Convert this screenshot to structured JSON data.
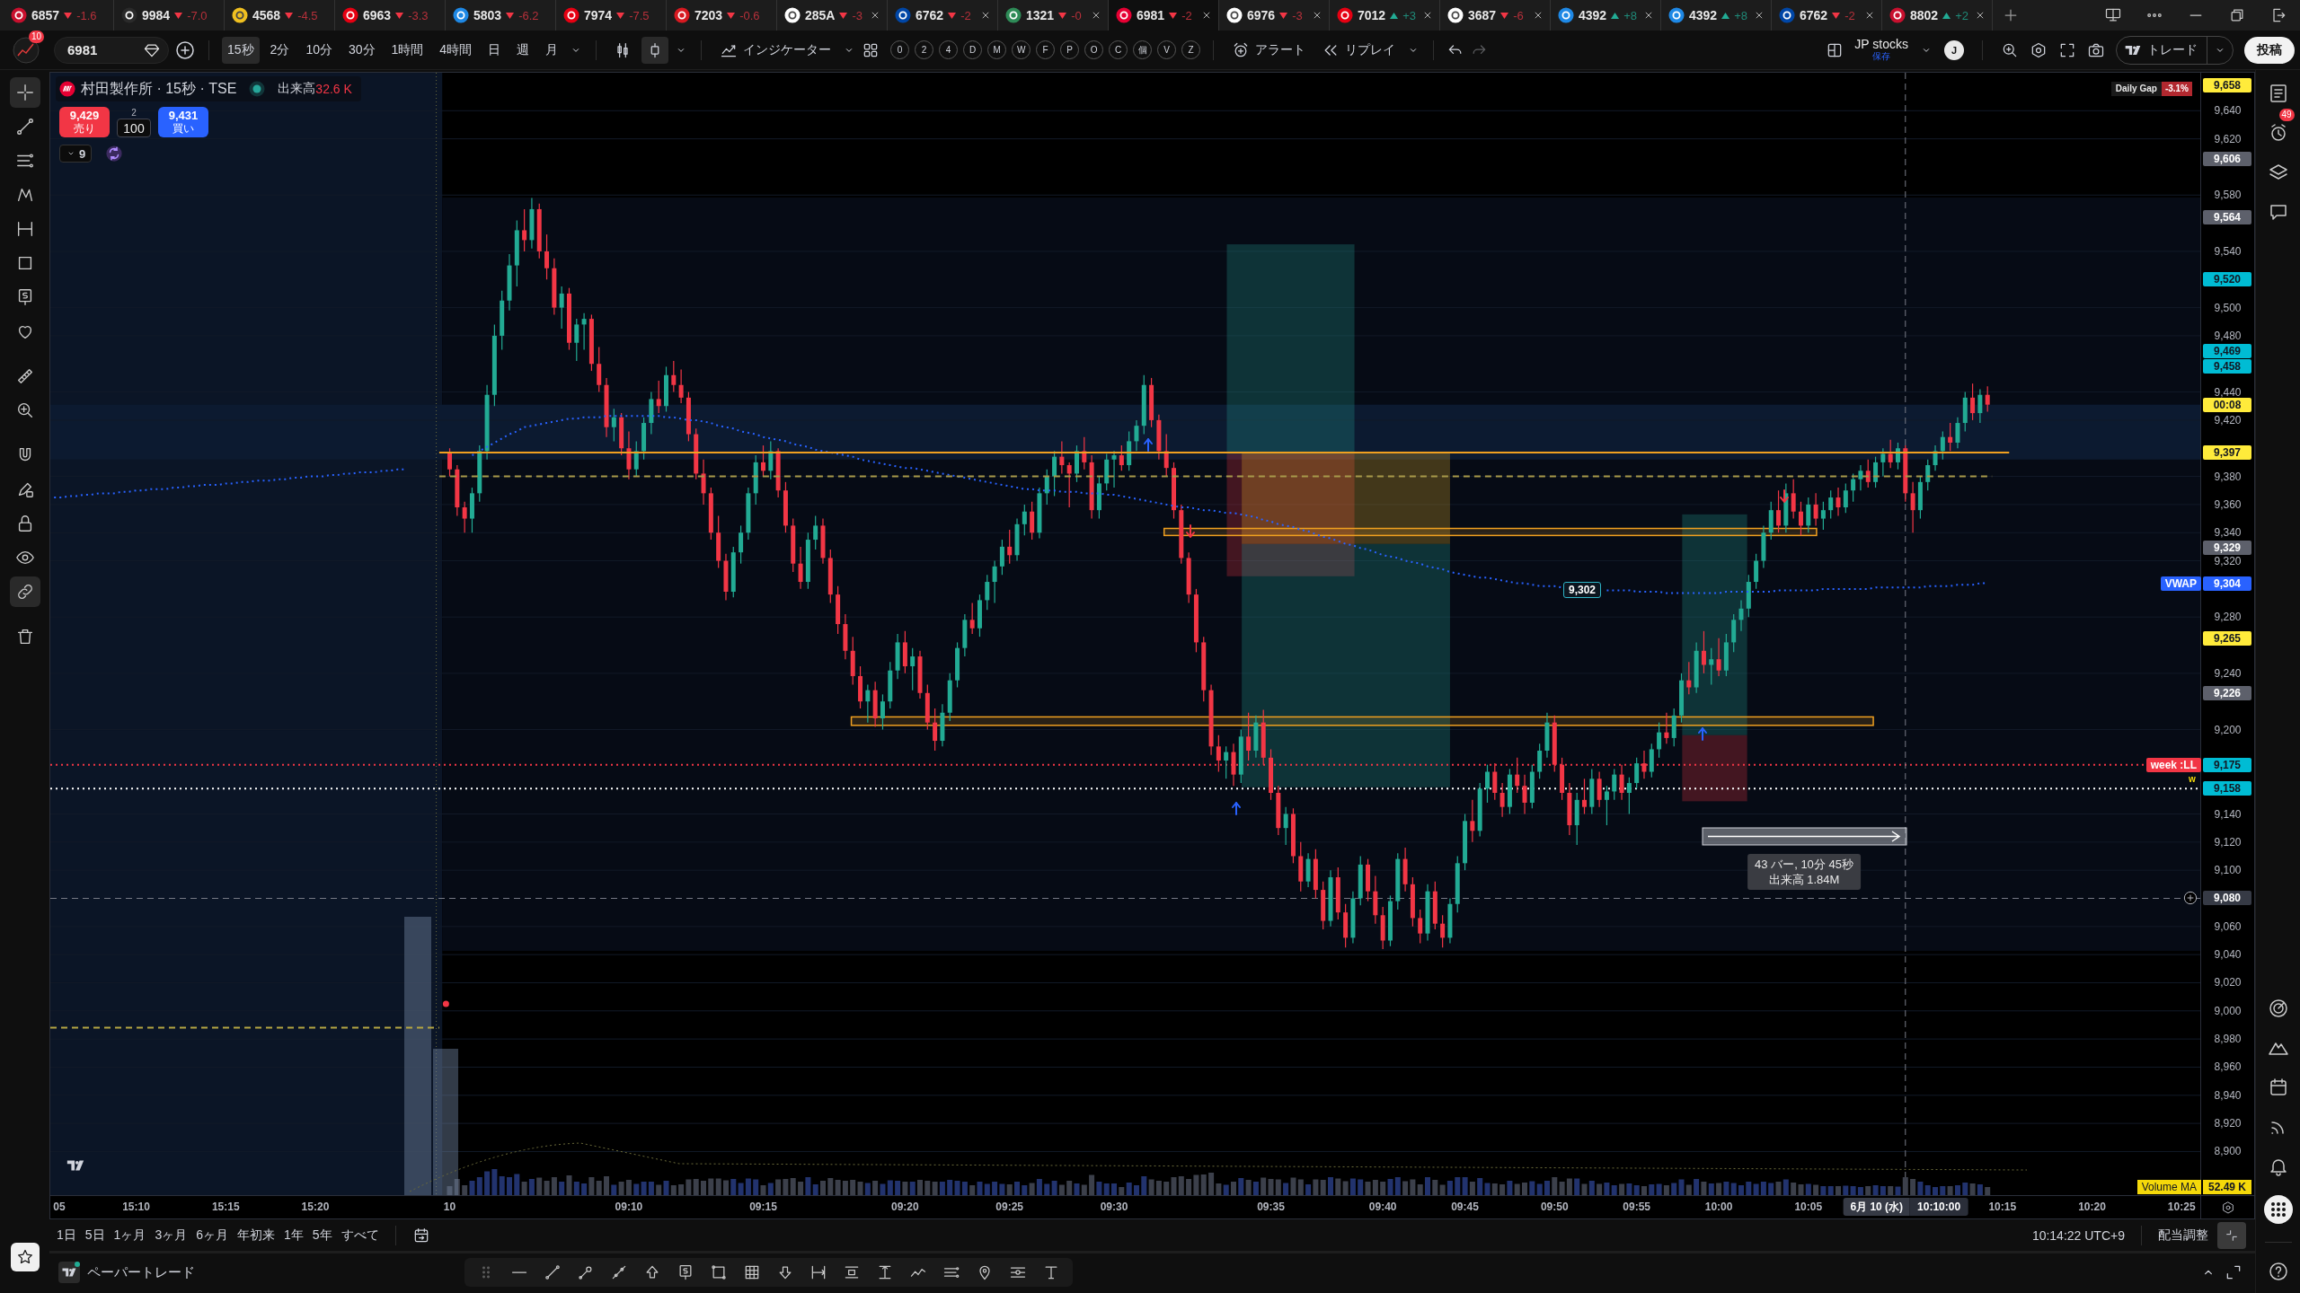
{
  "tabs": [
    {
      "symbol": "6857",
      "rising": false,
      "change": "-1.6",
      "color": "#c8102e",
      "closable": false,
      "selected": false
    },
    {
      "symbol": "9984",
      "rising": false,
      "change": "-7.0",
      "color": "#2a2a2a",
      "closable": false,
      "selected": false
    },
    {
      "symbol": "4568",
      "rising": false,
      "change": "-4.5",
      "color": "#f0c020",
      "closable": false,
      "selected": false
    },
    {
      "symbol": "6963",
      "rising": false,
      "change": "-3.3",
      "color": "#e60012",
      "closable": false,
      "selected": false
    },
    {
      "symbol": "5803",
      "rising": false,
      "change": "-6.2",
      "color": "#1e88e5",
      "closable": false,
      "selected": false
    },
    {
      "symbol": "7974",
      "rising": false,
      "change": "-7.5",
      "color": "#e60012",
      "closable": false,
      "selected": false
    },
    {
      "symbol": "7203",
      "rising": false,
      "change": "-0.6",
      "color": "#d71920",
      "closable": false,
      "selected": false
    },
    {
      "symbol": "285A",
      "rising": false,
      "change": "-3",
      "color": "#ffffff",
      "closable": true,
      "selected": false
    },
    {
      "symbol": "6762",
      "rising": false,
      "change": "-2",
      "color": "#0046a6",
      "closable": true,
      "selected": false
    },
    {
      "symbol": "1321",
      "rising": false,
      "change": "-0",
      "color": "#2e8b57",
      "closable": true,
      "selected": false
    },
    {
      "symbol": "6981",
      "rising": false,
      "change": "-2",
      "color": "#e60033",
      "closable": true,
      "selected": true
    },
    {
      "symbol": "6976",
      "rising": false,
      "change": "-3",
      "color": "#ffffff",
      "closable": true,
      "selected": false
    },
    {
      "symbol": "7012",
      "rising": true,
      "change": "+3",
      "color": "#e60012",
      "closable": true,
      "selected": false
    },
    {
      "symbol": "3687",
      "rising": false,
      "change": "-6",
      "color": "#ffffff",
      "closable": true,
      "selected": false
    },
    {
      "symbol": "4392",
      "rising": true,
      "change": "+8",
      "color": "#1e88e5",
      "closable": true,
      "selected": false
    },
    {
      "symbol": "4392",
      "rising": true,
      "change": "+8",
      "color": "#1e88e5",
      "closable": true,
      "selected": false
    },
    {
      "symbol": "6762",
      "rising": false,
      "change": "-2",
      "color": "#0046a6",
      "closable": true,
      "selected": false
    },
    {
      "symbol": "8802",
      "rising": true,
      "change": "+2",
      "color": "#c8102e",
      "closable": true,
      "selected": false
    }
  ],
  "toolbar": {
    "avatar_badge": "10",
    "symbol": "6981",
    "intervals": [
      {
        "label": "15秒",
        "selected": true
      },
      {
        "label": "2分",
        "selected": false
      },
      {
        "label": "10分",
        "selected": false
      },
      {
        "label": "30分",
        "selected": false
      },
      {
        "label": "1時間",
        "selected": false
      },
      {
        "label": "4時間",
        "selected": false
      },
      {
        "label": "日",
        "selected": false
      },
      {
        "label": "週",
        "selected": false
      },
      {
        "label": "月",
        "selected": false
      }
    ],
    "chart_types": [
      {
        "kind": "candles",
        "selected": false
      },
      {
        "kind": "hollow",
        "selected": true
      }
    ],
    "indicators": "インジケーター",
    "quick_buttons": [
      "0",
      "2",
      "4",
      "D",
      "M",
      "W",
      "F",
      "P",
      "O",
      "C",
      "個",
      "V",
      "Z"
    ],
    "alert": "アラート",
    "replay": "リプレイ",
    "layout_name": "JP stocks",
    "layout_status": "保存",
    "user_initial": "J",
    "trade": "トレード",
    "publish": "投稿"
  },
  "left_tools": [
    {
      "selected": true
    },
    {
      "selected": false
    },
    {
      "selected": false
    },
    {
      "selected": false
    },
    {
      "selected": false
    },
    {
      "selected": false
    },
    {
      "selected": false
    },
    {
      "selected": false
    },
    {
      "selected": false
    },
    {
      "selected": false
    },
    {
      "selected": false
    },
    {
      "selected": false
    },
    {
      "selected": false
    },
    {
      "selected": false
    },
    {
      "selected": true
    },
    {
      "selected": false
    }
  ],
  "chart": {
    "legend": {
      "title": "村田製作所 · 15秒 · TSE",
      "market_open": true,
      "volume_label": "出来高",
      "volume": "32.6 K",
      "sell_price": "9,429",
      "sell_label": "売り",
      "spread": "2",
      "quantity": "100",
      "buy_price": "9,431",
      "buy_label": "買い",
      "indicator_count": "9"
    },
    "daily_gap": {
      "label": "Daily Gap",
      "value": "-3.1%"
    },
    "measure": {
      "bars": "43 バー, 10分 45秒",
      "volume": "出来高 1.84M"
    },
    "crosshair": {
      "date": "6月 10 (水)",
      "time": "10:10:00"
    },
    "volume_ma": {
      "label": "Volume MA",
      "value": "52.49 K"
    },
    "price_scale": {
      "countdown": "00:08",
      "tags": [
        {
          "label": "9,658",
          "color": "#ffeb3b"
        },
        {
          "label": "9,606",
          "color": "#5d606b"
        },
        {
          "label": "9,564",
          "color": "#5d606b"
        },
        {
          "label": "9,520",
          "color": "#00bcd4"
        },
        {
          "label": "9,469",
          "color": "#00bcd4"
        },
        {
          "label": "9,458",
          "color": "#00bcd4"
        },
        {
          "label": "9,397",
          "color": "#ffeb3b"
        },
        {
          "label": "9,329",
          "color": "#5d606b"
        },
        {
          "label": "9,304",
          "color": "#2962ff"
        },
        {
          "label": "9,265",
          "color": "#ffeb3b"
        },
        {
          "label": "9,226",
          "color": "#5d606b"
        },
        {
          "label": "9,175",
          "color": "#00bcd4"
        },
        {
          "label": "9,158",
          "color": "#00bcd4"
        },
        {
          "label": "9,080",
          "color": "#363a45"
        }
      ]
    },
    "chart_data": {
      "type": "candlestick",
      "ylim": [
        8869,
        9667
      ],
      "grid": true,
      "categories": [
        "05",
        null,
        null,
        null,
        null,
        null,
        null,
        null,
        null,
        null,
        null,
        "15:10",
        null,
        null,
        null,
        null,
        null,
        null,
        null,
        null,
        null,
        null,
        null,
        "15:15",
        null,
        null,
        null,
        null,
        null,
        null,
        null,
        null,
        null,
        null,
        null,
        "15:20",
        null,
        null,
        null,
        null,
        null,
        null,
        null,
        null,
        null,
        null,
        null,
        null,
        null,
        null,
        null,
        null,
        null,
        "10",
        null,
        null,
        null,
        null,
        null,
        null,
        null,
        null,
        null,
        null,
        null,
        null,
        null,
        null,
        null,
        null,
        null,
        null,
        null,
        null,
        null,
        null,
        null,
        "09:10",
        null,
        null,
        null,
        null,
        null,
        null,
        null,
        null,
        null,
        null,
        null,
        null,
        null,
        null,
        null,
        null,
        null,
        "09:15",
        null,
        null,
        null,
        null,
        null,
        null,
        null,
        null,
        null,
        null,
        null,
        null,
        null,
        null,
        null,
        null,
        null,
        null,
        "09:20",
        null,
        null,
        null,
        null,
        null,
        null,
        null,
        null,
        null,
        null,
        null,
        null,
        null,
        "09:25",
        null,
        null,
        null,
        null,
        null,
        null,
        null,
        null,
        null,
        null,
        null,
        null,
        null,
        "09:30",
        null,
        null,
        null,
        null,
        null,
        null,
        null,
        null,
        null,
        null,
        null,
        null,
        null,
        null,
        null,
        null,
        null,
        null,
        null,
        null,
        "09:35",
        null,
        null,
        null,
        null,
        null,
        null,
        null,
        null,
        null,
        null,
        null,
        null,
        null,
        null,
        "09:40",
        null,
        null,
        null,
        null,
        null,
        null,
        null,
        null,
        null,
        null,
        "09:45",
        null,
        null,
        null,
        null,
        null,
        null,
        null,
        null,
        null,
        null,
        null,
        "09:50",
        null,
        null,
        null,
        null,
        null,
        null,
        null,
        null,
        null,
        null,
        "09:55",
        null,
        null,
        null,
        null,
        null,
        null,
        null,
        null,
        null,
        null,
        "10:00",
        null,
        null,
        null,
        null,
        null,
        null,
        null,
        null,
        null,
        null,
        null,
        "10:05",
        null,
        null,
        null,
        null,
        null,
        null,
        null,
        null,
        null,
        null,
        null,
        null,
        null,
        null,
        null,
        null,
        null,
        null,
        null,
        null,
        null,
        null,
        null,
        null,
        null,
        "10:15",
        null,
        null,
        null,
        null,
        null,
        null,
        null,
        null,
        null,
        null,
        null,
        "10:20",
        null,
        null,
        null,
        null,
        null,
        null,
        null,
        null,
        null,
        null,
        null,
        "10:25",
        null,
        null
      ],
      "yticks": [
        {
          "value": 9640,
          "label": "9,640"
        },
        {
          "value": 9620,
          "label": "9,620"
        },
        {
          "value": 9580,
          "label": "9,580"
        },
        {
          "value": 9540,
          "label": "9,540"
        },
        {
          "value": 9500,
          "label": "9,500"
        },
        {
          "value": 9480,
          "label": "9,480"
        },
        {
          "value": 9440,
          "label": "9,440"
        },
        {
          "value": 9420,
          "label": "9,420"
        },
        {
          "value": 9380,
          "label": "9,380"
        },
        {
          "value": 9360,
          "label": "9,360"
        },
        {
          "value": 9340,
          "label": "9,340"
        },
        {
          "value": 9320,
          "label": "9,320"
        },
        {
          "value": 9280,
          "label": "9,280"
        },
        {
          "value": 9240,
          "label": "9,240"
        },
        {
          "value": 9200,
          "label": "9,200"
        },
        {
          "value": 9140,
          "label": "9,140"
        },
        {
          "value": 9120,
          "label": "9,120"
        },
        {
          "value": 9100,
          "label": "9,100"
        },
        {
          "value": 9060,
          "label": "9,060"
        },
        {
          "value": 9040,
          "label": "9,040"
        },
        {
          "value": 9020,
          "label": "9,020"
        },
        {
          "value": 9000,
          "label": "9,000"
        },
        {
          "value": 8980,
          "label": "8,980"
        },
        {
          "value": 8960,
          "label": "8,960"
        },
        {
          "value": 8940,
          "label": "8,940"
        },
        {
          "value": 8920,
          "label": "8,920"
        },
        {
          "value": 8900,
          "label": "8,900"
        }
      ],
      "bands": [
        {
          "axis": "y",
          "from": 9392,
          "to": 9431,
          "color": "#0c1a30"
        }
      ],
      "ohlc": [
        null,
        null,
        null,
        null,
        null,
        null,
        null,
        null,
        null,
        null,
        null,
        null,
        null,
        null,
        null,
        null,
        null,
        null,
        null,
        null,
        null,
        null,
        null,
        null,
        null,
        null,
        null,
        null,
        null,
        null,
        null,
        null,
        null,
        null,
        null,
        null,
        null,
        null,
        null,
        null,
        null,
        null,
        null,
        null,
        null,
        null,
        null,
        null,
        null,
        null,
        null,
        null,
        null,
        [
          9397,
          9400,
          9380,
          9385
        ],
        [
          9385,
          9388,
          9352,
          9358
        ],
        [
          9358,
          9362,
          9340,
          9350
        ],
        [
          9350,
          9372,
          9340,
          9368
        ],
        [
          9368,
          9402,
          9362,
          9398
        ],
        [
          9398,
          9445,
          9392,
          9438
        ],
        [
          9438,
          9488,
          9430,
          9480
        ],
        [
          9480,
          9512,
          9470,
          9505
        ],
        [
          9505,
          9538,
          9498,
          9530
        ],
        [
          9530,
          9562,
          9515,
          9555
        ],
        [
          9555,
          9570,
          9540,
          9548
        ],
        [
          9548,
          9578,
          9542,
          9570
        ],
        [
          9570,
          9574,
          9535,
          9540
        ],
        [
          9540,
          9552,
          9520,
          9528
        ],
        [
          9528,
          9535,
          9495,
          9500
        ],
        [
          9500,
          9515,
          9485,
          9510
        ],
        [
          9510,
          9514,
          9470,
          9475
        ],
        [
          9475,
          9492,
          9462,
          9488
        ],
        [
          9488,
          9496,
          9470,
          9492
        ],
        [
          9492,
          9495,
          9455,
          9460
        ],
        [
          9460,
          9472,
          9440,
          9445
        ],
        [
          9445,
          9450,
          9408,
          9415
        ],
        [
          9415,
          9428,
          9405,
          9422
        ],
        [
          9422,
          9425,
          9395,
          9400
        ],
        [
          9400,
          9412,
          9378,
          9385
        ],
        [
          9385,
          9405,
          9380,
          9398
        ],
        [
          9398,
          9422,
          9392,
          9418
        ],
        [
          9418,
          9440,
          9410,
          9435
        ],
        [
          9435,
          9448,
          9425,
          9430
        ],
        [
          9430,
          9458,
          9426,
          9452
        ],
        [
          9452,
          9462,
          9440,
          9445
        ],
        [
          9445,
          9456,
          9432,
          9436
        ],
        [
          9436,
          9440,
          9405,
          9410
        ],
        [
          9410,
          9414,
          9378,
          9382
        ],
        [
          9382,
          9392,
          9360,
          9368
        ],
        [
          9368,
          9372,
          9335,
          9340
        ],
        [
          9340,
          9352,
          9315,
          9320
        ],
        [
          9320,
          9325,
          9292,
          9298
        ],
        [
          9298,
          9330,
          9294,
          9326
        ],
        [
          9326,
          9345,
          9318,
          9340
        ],
        [
          9340,
          9372,
          9335,
          9368
        ],
        [
          9368,
          9395,
          9360,
          9390
        ],
        [
          9390,
          9402,
          9380,
          9384
        ],
        [
          9384,
          9405,
          9378,
          9398
        ],
        [
          9398,
          9400,
          9365,
          9370
        ],
        [
          9370,
          9376,
          9340,
          9345
        ],
        [
          9345,
          9350,
          9312,
          9318
        ],
        [
          9318,
          9330,
          9300,
          9305
        ],
        [
          9305,
          9340,
          9300,
          9335
        ],
        [
          9335,
          9352,
          9328,
          9345
        ],
        [
          9345,
          9350,
          9318,
          9322
        ],
        [
          9322,
          9328,
          9290,
          9296
        ],
        [
          9296,
          9302,
          9268,
          9275
        ],
        [
          9275,
          9282,
          9250,
          9256
        ],
        [
          9256,
          9266,
          9232,
          9238
        ],
        [
          9238,
          9245,
          9215,
          9220
        ],
        [
          9220,
          9232,
          9205,
          9228
        ],
        [
          9228,
          9234,
          9202,
          9208
        ],
        [
          9208,
          9225,
          9200,
          9220
        ],
        [
          9220,
          9248,
          9215,
          9242
        ],
        [
          9242,
          9268,
          9236,
          9262
        ],
        [
          9262,
          9270,
          9240,
          9245
        ],
        [
          9245,
          9258,
          9228,
          9252
        ],
        [
          9252,
          9256,
          9222,
          9226
        ],
        [
          9226,
          9232,
          9200,
          9205
        ],
        [
          9205,
          9215,
          9185,
          9192
        ],
        [
          9192,
          9218,
          9188,
          9212
        ],
        [
          9212,
          9240,
          9206,
          9235
        ],
        [
          9235,
          9262,
          9230,
          9258
        ],
        [
          9258,
          9282,
          9252,
          9278
        ],
        [
          9278,
          9290,
          9268,
          9272
        ],
        [
          9272,
          9296,
          9266,
          9292
        ],
        [
          9292,
          9310,
          9285,
          9305
        ],
        [
          9305,
          9320,
          9290,
          9316
        ],
        [
          9316,
          9335,
          9310,
          9330
        ],
        [
          9330,
          9342,
          9318,
          9324
        ],
        [
          9324,
          9350,
          9320,
          9346
        ],
        [
          9346,
          9360,
          9338,
          9355
        ],
        [
          9355,
          9362,
          9335,
          9340
        ],
        [
          9340,
          9372,
          9336,
          9368
        ],
        [
          9368,
          9385,
          9360,
          9380
        ],
        [
          9380,
          9398,
          9366,
          9394
        ],
        [
          9394,
          9405,
          9382,
          9388
        ],
        [
          9388,
          9390,
          9358,
          9382
        ],
        [
          9382,
          9402,
          9376,
          9398
        ],
        [
          9398,
          9408,
          9385,
          9390
        ],
        [
          9390,
          9395,
          9350,
          9356
        ],
        [
          9356,
          9380,
          9350,
          9375
        ],
        [
          9375,
          9396,
          9370,
          9392
        ],
        [
          9392,
          9398,
          9372,
          9395
        ],
        [
          9395,
          9402,
          9384,
          9388
        ],
        [
          9388,
          9412,
          9384,
          9405
        ],
        [
          9405,
          9420,
          9398,
          9416
        ],
        [
          9416,
          9452,
          9410,
          9445
        ],
        [
          9445,
          9450,
          9415,
          9420
        ],
        [
          9420,
          9424,
          9392,
          9398
        ],
        [
          9398,
          9410,
          9380,
          9386
        ],
        [
          9386,
          9390,
          9350,
          9356
        ],
        [
          9356,
          9360,
          9318,
          9322
        ],
        [
          9322,
          9326,
          9290,
          9296
        ],
        [
          9296,
          9300,
          9255,
          9262
        ],
        [
          9262,
          9266,
          9220,
          9228
        ],
        [
          9228,
          9232,
          9182,
          9188
        ],
        [
          9188,
          9196,
          9170,
          9178
        ],
        [
          9178,
          9188,
          9165,
          9184
        ],
        [
          9184,
          9190,
          9160,
          9168
        ],
        [
          9168,
          9200,
          9162,
          9195
        ],
        [
          9195,
          9212,
          9178,
          9185
        ],
        [
          9185,
          9210,
          9180,
          9205
        ],
        [
          9205,
          9214,
          9175,
          9180
        ],
        [
          9180,
          9186,
          9150,
          9155
        ],
        [
          9155,
          9160,
          9125,
          9130
        ],
        [
          9130,
          9145,
          9118,
          9140
        ],
        [
          9140,
          9144,
          9105,
          9110
        ],
        [
          9110,
          9120,
          9085,
          9092
        ],
        [
          9092,
          9112,
          9088,
          9108
        ],
        [
          9108,
          9115,
          9080,
          9086
        ],
        [
          9086,
          9092,
          9058,
          9064
        ],
        [
          9064,
          9100,
          9060,
          9095
        ],
        [
          9095,
          9102,
          9065,
          9070
        ],
        [
          9070,
          9076,
          9045,
          9052
        ],
        [
          9052,
          9085,
          9048,
          9080
        ],
        [
          9080,
          9110,
          9075,
          9104
        ],
        [
          9104,
          9108,
          9078,
          9085
        ],
        [
          9085,
          9096,
          9062,
          9068
        ],
        [
          9068,
          9074,
          9044,
          9050
        ],
        [
          9050,
          9082,
          9046,
          9078
        ],
        [
          9078,
          9112,
          9072,
          9108
        ],
        [
          9108,
          9116,
          9085,
          9090
        ],
        [
          9090,
          9095,
          9060,
          9066
        ],
        [
          9066,
          9072,
          9048,
          9055
        ],
        [
          9055,
          9090,
          9050,
          9085
        ],
        [
          9085,
          9092,
          9058,
          9062
        ],
        [
          9062,
          9068,
          9045,
          9052
        ],
        [
          9052,
          9080,
          9048,
          9076
        ],
        [
          9076,
          9110,
          9070,
          9105
        ],
        [
          9105,
          9140,
          9100,
          9135
        ],
        [
          9135,
          9150,
          9120,
          9128
        ],
        [
          9128,
          9162,
          9124,
          9158
        ],
        [
          9158,
          9175,
          9148,
          9170
        ],
        [
          9170,
          9176,
          9150,
          9155
        ],
        [
          9155,
          9162,
          9138,
          9145
        ],
        [
          9145,
          9172,
          9140,
          9168
        ],
        [
          9168,
          9180,
          9155,
          9160
        ],
        [
          9160,
          9168,
          9140,
          9148
        ],
        [
          9148,
          9175,
          9144,
          9170
        ],
        [
          9170,
          9190,
          9165,
          9185
        ],
        [
          9185,
          9212,
          9180,
          9205
        ],
        [
          9205,
          9210,
          9170,
          9175
        ],
        [
          9175,
          9180,
          9150,
          9155
        ],
        [
          9155,
          9162,
          9125,
          9132
        ],
        [
          9132,
          9155,
          9118,
          9150
        ],
        [
          9150,
          9165,
          9140,
          9145
        ],
        [
          9145,
          9172,
          9140,
          9165
        ],
        [
          9165,
          9170,
          9145,
          9150
        ],
        [
          9150,
          9160,
          9132,
          9156
        ],
        [
          9156,
          9172,
          9150,
          9168
        ],
        [
          9168,
          9175,
          9150,
          9155
        ],
        [
          9155,
          9166,
          9140,
          9162
        ],
        [
          9162,
          9180,
          9158,
          9176
        ],
        [
          9176,
          9185,
          9165,
          9170
        ],
        [
          9170,
          9190,
          9166,
          9186
        ],
        [
          9186,
          9205,
          9180,
          9198
        ],
        [
          9198,
          9212,
          9190,
          9194
        ],
        [
          9194,
          9215,
          9188,
          9210
        ],
        [
          9210,
          9240,
          9205,
          9235
        ],
        [
          9235,
          9248,
          9225,
          9230
        ],
        [
          9230,
          9262,
          9226,
          9256
        ],
        [
          9256,
          9270,
          9240,
          9246
        ],
        [
          9246,
          9258,
          9232,
          9250
        ],
        [
          9250,
          9265,
          9238,
          9242
        ],
        [
          9242,
          9268,
          9238,
          9262
        ],
        [
          9262,
          9282,
          9255,
          9278
        ],
        [
          9278,
          9292,
          9270,
          9286
        ],
        [
          9286,
          9310,
          9280,
          9305
        ],
        [
          9305,
          9325,
          9300,
          9320
        ],
        [
          9320,
          9345,
          9315,
          9340
        ],
        [
          9340,
          9362,
          9335,
          9356
        ],
        [
          9356,
          9370,
          9340,
          9345
        ],
        [
          9345,
          9375,
          9340,
          9368
        ],
        [
          9368,
          9378,
          9350,
          9355
        ],
        [
          9355,
          9362,
          9338,
          9345
        ],
        [
          9345,
          9365,
          9340,
          9360
        ],
        [
          9360,
          9368,
          9345,
          9350
        ],
        [
          9350,
          9362,
          9342,
          9356
        ],
        [
          9356,
          9370,
          9350,
          9365
        ],
        [
          9365,
          9372,
          9352,
          9358
        ],
        [
          9358,
          9375,
          9354,
          9370
        ],
        [
          9370,
          9382,
          9362,
          9378
        ],
        [
          9378,
          9388,
          9370,
          9384
        ],
        [
          9384,
          9392,
          9372,
          9376
        ],
        [
          9376,
          9394,
          9372,
          9390
        ],
        [
          9390,
          9400,
          9380,
          9396
        ],
        [
          9396,
          9406,
          9386,
          9390
        ],
        [
          9390,
          9404,
          9385,
          9400
        ],
        [
          9400,
          9402,
          9362,
          9368
        ],
        [
          9368,
          9376,
          9340,
          9356
        ],
        [
          9356,
          9380,
          9350,
          9376
        ],
        [
          9376,
          9392,
          9370,
          9388
        ],
        [
          9388,
          9402,
          9384,
          9398
        ],
        [
          9398,
          9412,
          9392,
          9408
        ],
        [
          9408,
          9418,
          9398,
          9404
        ],
        [
          9404,
          9422,
          9400,
          9418
        ],
        [
          9418,
          9440,
          9412,
          9436
        ],
        [
          9436,
          9446,
          9420,
          9425
        ],
        [
          9425,
          9442,
          9418,
          9438
        ],
        [
          9438,
          9444,
          9426,
          9431
        ],
        null,
        null,
        null,
        null,
        null,
        null,
        null,
        null,
        null,
        null,
        null,
        null,
        null,
        null,
        null,
        null,
        null,
        null,
        null,
        null,
        null,
        null,
        null,
        null,
        null,
        null,
        null,
        null
      ],
      "series": [
        {
          "name": "VWAP",
          "type": "line",
          "color": "#2962ff",
          "line_style": "dotted",
          "values": [
            9365,
            9365,
            9366,
            9366,
            9367,
            9367,
            9368,
            9368,
            9368,
            9369,
            9369,
            9370,
            9370,
            9371,
            9371,
            9371,
            9372,
            9372,
            9373,
            9373,
            9374,
            9374,
            9374,
            9375,
            9375,
            9376,
            9376,
            9377,
            9377,
            9377,
            9378,
            9378,
            9379,
            9379,
            9380,
            9380,
            9380,
            9381,
            9381,
            9382,
            9382,
            9383,
            9383,
            9383,
            9384,
            9384,
            9385,
            9385,
            null,
            null,
            null,
            null,
            null,
            null,
            null,
            null,
            9395,
            9398,
            9401,
            9404,
            9407,
            9410,
            9412,
            9415,
            9416,
            9417,
            9418,
            9419,
            9420,
            9421,
            9421,
            9422,
            9422,
            9422,
            9423,
            9423,
            9423,
            9423,
            9423,
            9423,
            9423,
            9423,
            9422,
            9422,
            9421,
            9420,
            9420,
            9419,
            9418,
            9416,
            9415,
            9414,
            9412,
            9411,
            9410,
            9408,
            9407,
            9406,
            9405,
            9403,
            9402,
            9401,
            9399,
            9398,
            9397,
            9396,
            9395,
            9394,
            9392,
            9391,
            9390,
            9389,
            9388,
            9387,
            9386,
            9386,
            9385,
            9384,
            9383,
            9382,
            9381,
            9380,
            9379,
            9378,
            9377,
            9376,
            9375,
            9374,
            9373,
            9372,
            9371,
            9371,
            9370,
            9370,
            9370,
            9369,
            9369,
            9369,
            9368,
            9368,
            9368,
            9367,
            9367,
            9366,
            9365,
            9364,
            9363,
            9362,
            9361,
            9360,
            9359,
            9358,
            9358,
            9357,
            9356,
            9356,
            9355,
            9354,
            9354,
            9353,
            9352,
            9351,
            9349,
            9348,
            9346,
            9345,
            9344,
            9342,
            9341,
            9339,
            9337,
            9336,
            9334,
            9332,
            9331,
            9329,
            9328,
            9326,
            9324,
            9323,
            9322,
            9320,
            9319,
            9318,
            9316,
            9315,
            9314,
            9312,
            9311,
            9310,
            9309,
            9308,
            9308,
            9307,
            9306,
            9305,
            9304,
            9304,
            9303,
            9302,
            9302,
            9302,
            9301,
            null,
            null,
            null,
            null,
            null,
            9299,
            9299,
            9299,
            9299,
            9298,
            9298,
            9298,
            9298,
            9297,
            9297,
            9297,
            9297,
            9297,
            9297,
            9297,
            9297,
            9298,
            9298,
            9298,
            9298,
            9298,
            9298,
            9298,
            9299,
            9299,
            9299,
            9299,
            9299,
            9299,
            9300,
            9300,
            9300,
            9300,
            9300,
            9300,
            9300,
            9301,
            9301,
            9301,
            9301,
            9301,
            9301,
            9301,
            9302,
            9302,
            9302,
            9302,
            9303,
            9303,
            9303,
            9304,
            9304,
            null,
            null,
            null,
            null,
            null,
            null,
            null,
            null,
            null,
            null,
            null,
            null,
            null,
            null,
            null,
            null,
            null,
            null,
            null,
            null,
            null,
            null,
            null,
            null,
            null,
            null,
            null,
            null
          ]
        }
      ],
      "ref_lines": [
        {
          "axis": "y",
          "value": 9175,
          "label": "week :LL",
          "color": "#f23645",
          "line_style": "dotted"
        },
        {
          "axis": "y",
          "value": 9158,
          "color": "#ffffff",
          "line_style": "dotted"
        },
        {
          "axis": "y",
          "value": 9080,
          "color": "#787b86",
          "line_style": "dashed"
        }
      ],
      "annotations": [
        "9,302",
        "w"
      ]
    }
  },
  "right_sidebar": {
    "alerts_badge": "49"
  },
  "bottom_bar": {
    "ranges": [
      "1日",
      "5日",
      "1ヶ月",
      "3ヶ月",
      "6ヶ月",
      "年初来",
      "1年",
      "5年",
      "すべて"
    ],
    "clock": "10:14:22 UTC+9",
    "adjustment": "配当調整"
  },
  "bottom_panel": {
    "title": "ペーパートレード"
  }
}
